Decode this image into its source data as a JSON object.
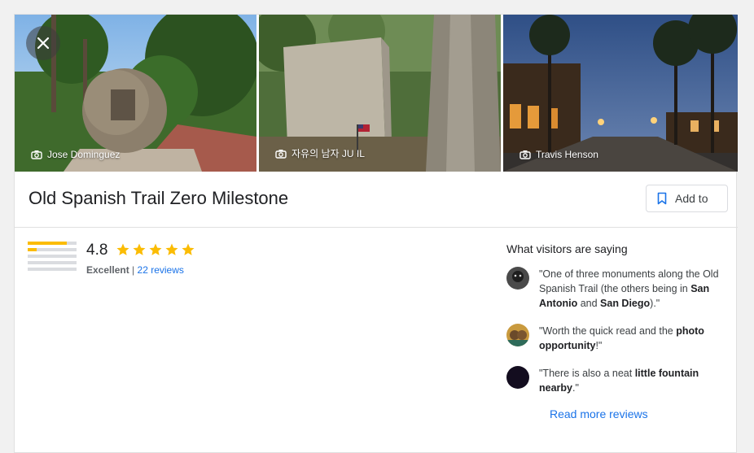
{
  "gallery": {
    "photos": [
      {
        "credit": "Jose Dominguez"
      },
      {
        "credit": "자유의 남자 JU IL"
      },
      {
        "credit": "Travis Henson"
      }
    ]
  },
  "place": {
    "title": "Old Spanish Trail Zero Milestone",
    "add_to_label": "Add to"
  },
  "rating": {
    "score": "4.8",
    "stars": 5,
    "label": "Excellent",
    "separator": "|",
    "reviews_text": "22 reviews",
    "distribution": [
      0.8,
      0.18,
      0,
      0,
      0
    ]
  },
  "visitors": {
    "heading": "What visitors are saying",
    "quotes": [
      {
        "segments": [
          "\"One of three monuments along the Old Spanish Trail (the others being in ",
          "San Antonio",
          " and ",
          "San Diego",
          ").\""
        ]
      },
      {
        "segments": [
          "\"Worth the quick read and the ",
          "photo opportunity",
          "!\""
        ]
      },
      {
        "segments": [
          "\"There is also a neat ",
          "little fountain nearby",
          ".\""
        ]
      }
    ],
    "read_more": "Read more reviews"
  },
  "colors": {
    "star": "#fbbc04",
    "link": "#1a73e8"
  },
  "icons": [
    "close-icon",
    "camera-icon",
    "bookmark-icon",
    "star-icon"
  ]
}
